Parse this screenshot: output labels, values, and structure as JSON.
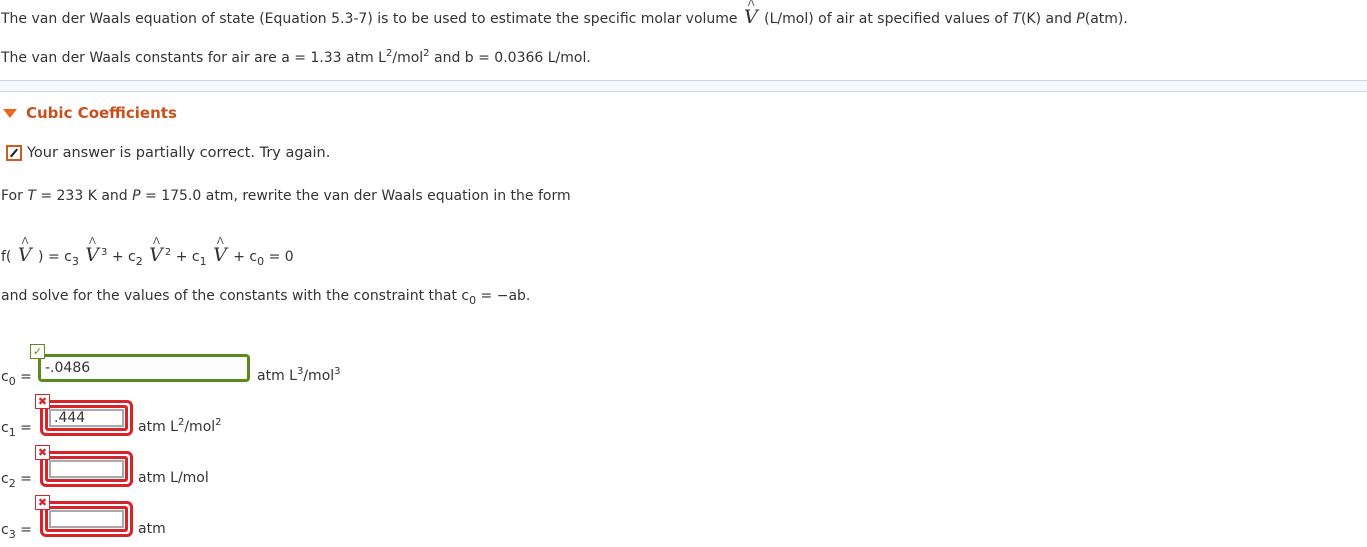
{
  "intro": {
    "line1_a": "The van der Waals equation of state (Equation 5.3-7) is to be used to estimate the specific molar volume",
    "line1_v": "V",
    "line1_b": "(L/mol) of air at specified values of",
    "line1_T": "T",
    "line1_c": "(K) and",
    "line1_P": "P",
    "line1_d": "(atm).",
    "line2_a": "The van der Waals constants for air are a = 1.33 atm L",
    "line2_sup1": "2",
    "line2_b": "/mol",
    "line2_sup2": "2",
    "line2_c": " and b = 0.0366 L/mol."
  },
  "section": {
    "title": "Cubic Coefficients",
    "expanded": true
  },
  "status": {
    "icon": "pencil-icon",
    "text": "Your answer is partially correct.  Try again."
  },
  "prompt": {
    "a": "For ",
    "T": "T",
    "b": " = 233 K and ",
    "P": "P",
    "c": " = 175.0 atm, rewrite the van der Waals equation in the form"
  },
  "equation": {
    "f_open": "f(",
    "V": "V",
    "f_close": ") = c",
    "sub3": "3",
    "pow3": "3",
    "plus_c": " + c",
    "sub2": "2",
    "pow2": "2",
    "plus_c1": " + c",
    "sub1": "1",
    "plus_c0": " + c",
    "sub0": "0",
    "eq0": " = 0"
  },
  "constraint": {
    "a": "and solve for the values of the constants with the constraint that c",
    "sub": "0",
    "b": " = −ab."
  },
  "answers": [
    {
      "label": "c",
      "sub": "0",
      "value": "-.0486",
      "status": "correct",
      "unit_a": "atm L",
      "unit_sup1": "3",
      "unit_b": "/mol",
      "unit_sup2": "3"
    },
    {
      "label": "c",
      "sub": "1",
      "value": ".444",
      "status": "incorrect",
      "unit_a": "atm L",
      "unit_sup1": "2",
      "unit_b": "/mol",
      "unit_sup2": "2"
    },
    {
      "label": "c",
      "sub": "2",
      "value": "",
      "status": "incorrect",
      "unit_a": "atm L/mol",
      "unit_sup1": "",
      "unit_b": "",
      "unit_sup2": ""
    },
    {
      "label": "c",
      "sub": "3",
      "value": "",
      "status": "incorrect",
      "unit_a": "atm",
      "unit_sup1": "",
      "unit_b": "",
      "unit_sup2": ""
    }
  ],
  "badges": {
    "correct_glyph": "✓",
    "incorrect_glyph": "✖"
  },
  "colors": {
    "accent_orange": "#c8501a",
    "correct_green": "#5b8a1e",
    "incorrect_red": "#d9232a"
  },
  "hat_glyph": "Λ",
  "equals": "="
}
